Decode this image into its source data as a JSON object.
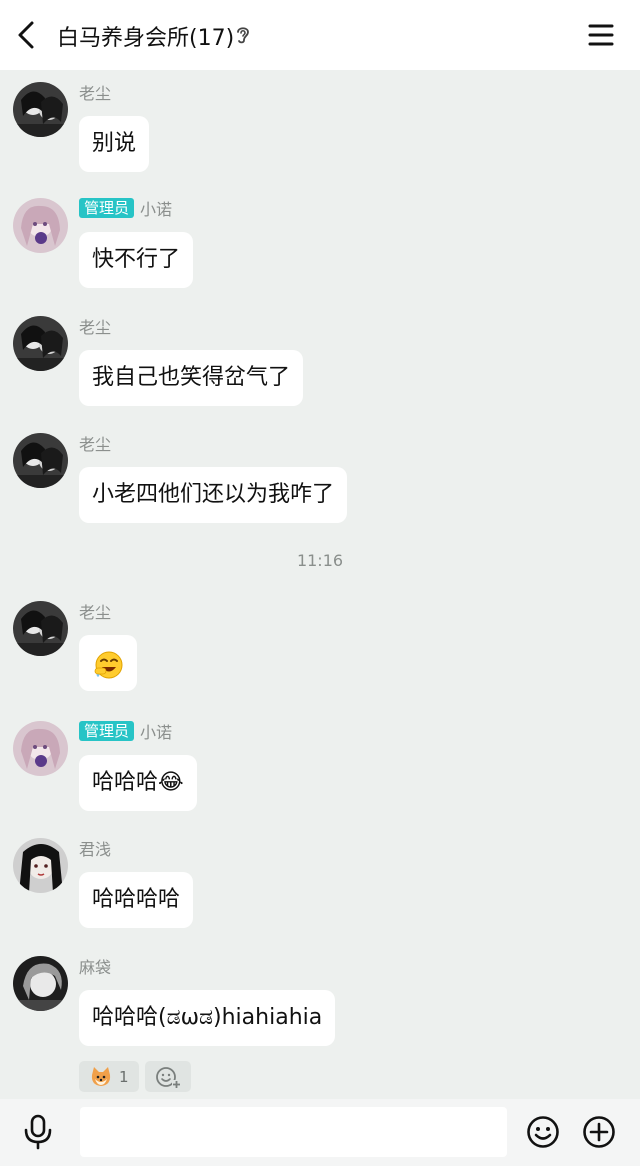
{
  "header": {
    "back_icon": "chevron-left-icon",
    "title": "白马养身会所(17)",
    "ear_icon": "ear-icon",
    "menu_icon": "hamburger-menu-icon"
  },
  "messages": [
    {
      "sender": "老尘",
      "admin_badge": "",
      "text": "别说",
      "avatar": "bw-anime-couple"
    },
    {
      "sender": "小诺",
      "admin_badge": "管理员",
      "text": "快不行了",
      "avatar": "pink-anime-girl"
    },
    {
      "sender": "老尘",
      "admin_badge": "",
      "text": "我自己也笑得岔气了",
      "avatar": "bw-anime-couple"
    },
    {
      "sender": "老尘",
      "admin_badge": "",
      "text": "小老四他们还以为我咋了",
      "avatar": "bw-anime-couple"
    },
    {
      "sender": "老尘",
      "admin_badge": "",
      "text": "",
      "emoji": "laughing-sweat-emoji",
      "avatar": "bw-anime-couple"
    },
    {
      "sender": "小诺",
      "admin_badge": "管理员",
      "text": "哈哈哈😂",
      "avatar": "pink-anime-girl"
    },
    {
      "sender": "君浅",
      "admin_badge": "",
      "text": "哈哈哈哈",
      "avatar": "dark-hair-girl"
    },
    {
      "sender": "麻袋",
      "admin_badge": "",
      "text": "哈哈哈(ಡωಡ)hiahiahia",
      "avatar": "grey-hair-boy"
    }
  ],
  "time_separator": "11:16",
  "reactions": [
    {
      "icon": "shiba-dog-icon",
      "count": "1"
    },
    {
      "icon": "add-reaction-icon",
      "count": ""
    }
  ],
  "input_bar": {
    "voice_icon": "microphone-icon",
    "input_value": "",
    "emoji_icon": "smiley-icon",
    "plus_icon": "plus-circle-icon"
  },
  "colors": {
    "chat_background": "#edf0ee",
    "admin_badge": "#27c4c6",
    "bubble": "#ffffff"
  }
}
